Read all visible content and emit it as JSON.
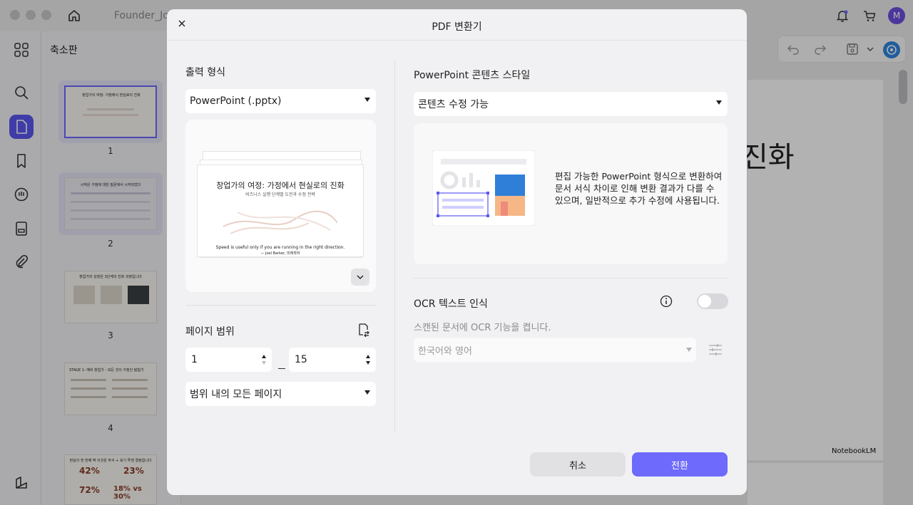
{
  "app": {
    "doc_tab": "Founder_Jo",
    "avatar_initial": "M",
    "accent": "#6e6afc"
  },
  "sidebar": {
    "title": "축소판",
    "icons": [
      "grid-icon",
      "search-icon",
      "document-icon",
      "bookmark-icon",
      "comment-icon",
      "form-icon",
      "attachment-icon",
      "layers-icon"
    ],
    "thumbnails": [
      {
        "page": "1",
        "title": "창업가의 여정: 가정에서 현실로의 진화"
      },
      {
        "page": "2",
        "title": "시작은 가정에 대한 질문에서 시작되었다"
      },
      {
        "page": "3",
        "title": "창업가의 성장은 3단계의 진화 과정입니다"
      },
      {
        "page": "4",
        "title": "STAGE 1: 예비 창업가 - 모든 것이 가정인 탐험기"
      },
      {
        "page": "",
        "title": "현실의 첫 번째 벽 이것은 부서 + 포기 투쟁 결정합니다",
        "stats": [
          "42%",
          "23%",
          "72%",
          "18% vs 30%"
        ]
      }
    ]
  },
  "background_page": {
    "big_text": "진화",
    "footer": "NotebookLM"
  },
  "dialog": {
    "title": "PDF 변환기",
    "output_format_label": "출력 형식",
    "output_format_value": "PowerPoint (.pptx)",
    "preview": {
      "slide_title": "창업가의 여정: 가정에서 현실로의 진화",
      "slide_subtitle": "비즈니스 실행 단계별 도전과 수정 전략",
      "quote": "Speed is useful only if you are running in the right direction.",
      "author": "— Joel Barker, 미래학자"
    },
    "page_range_label": "페이지 범위",
    "page_from": "1",
    "page_to": "15",
    "range_option": "범위 내의 모든 페이지",
    "style_label": "PowerPoint 콘텐츠 스타일",
    "style_value": "콘텐츠 수정 가능",
    "style_description": "편집 가능한 PowerPoint 형식으로 변환하여 문서 서식 차이로 인해 변환 결과가 다를 수 있으며, 일반적으로 추가 수정에 사용됩니다.",
    "ocr_label": "OCR 텍스트 인식",
    "ocr_description": "스캔된 문서에 OCR 기능을 켭니다.",
    "ocr_enabled": false,
    "ocr_language": "한국어와 영어",
    "cancel_label": "취소",
    "convert_label": "전환"
  }
}
